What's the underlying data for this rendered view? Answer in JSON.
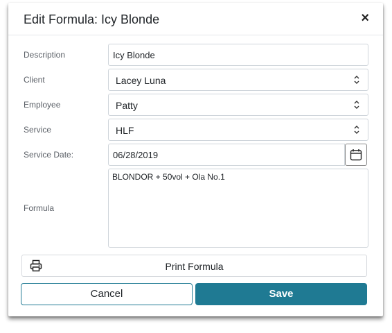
{
  "modal": {
    "title": "Edit Formula: Icy Blonde",
    "close_glyph": "×"
  },
  "form": {
    "description": {
      "label": "Description",
      "value": "Icy Blonde"
    },
    "client": {
      "label": "Client",
      "value": "Lacey Luna"
    },
    "employee": {
      "label": "Employee",
      "value": "Patty"
    },
    "service": {
      "label": "Service",
      "value": "HLF"
    },
    "service_date": {
      "label": "Service Date:",
      "value": "06/28/2019"
    },
    "formula": {
      "label": "Formula",
      "value": "BLONDOR + 50vol  + Ola No.1"
    }
  },
  "actions": {
    "print_label": "Print Formula",
    "cancel_label": "Cancel",
    "save_label": "Save"
  },
  "colors": {
    "accent": "#1f7a93"
  },
  "icons": [
    "close-icon",
    "select-arrows-icon",
    "calendar-icon",
    "printer-icon"
  ]
}
